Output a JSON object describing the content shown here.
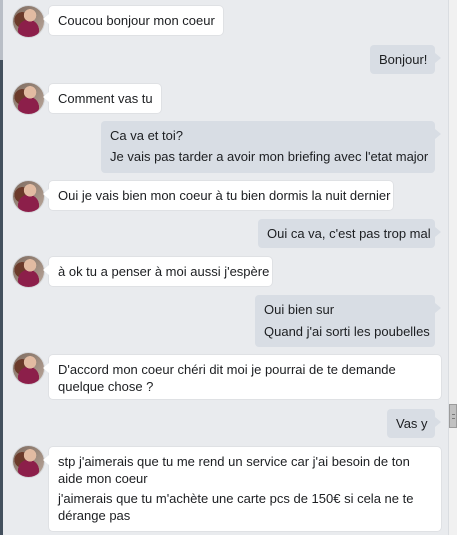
{
  "conversation": {
    "messages": [
      {
        "sender": "contact",
        "lines": [
          "Coucou bonjour mon coeur"
        ]
      },
      {
        "sender": "me",
        "lines": [
          "Bonjour!"
        ]
      },
      {
        "sender": "contact",
        "lines": [
          "Comment vas tu"
        ]
      },
      {
        "sender": "me",
        "lines": [
          "Ca va et toi?",
          "Je vais pas tarder a avoir mon briefing avec l'etat major"
        ]
      },
      {
        "sender": "contact",
        "lines": [
          "Oui je vais bien mon coeur à tu bien dormis la nuit dernier"
        ]
      },
      {
        "sender": "me",
        "lines": [
          "Oui ca va, c'est pas trop mal"
        ]
      },
      {
        "sender": "contact",
        "lines": [
          "à ok tu a penser à moi aussi j'espère"
        ]
      },
      {
        "sender": "me",
        "lines": [
          "Oui bien sur",
          "Quand j'ai sorti les poubelles"
        ]
      },
      {
        "sender": "contact",
        "lines": [
          "D'accord mon coeur chéri dit moi je pourrai de te demande",
          "quelque chose ?"
        ]
      },
      {
        "sender": "me",
        "lines": [
          "Vas y"
        ]
      },
      {
        "sender": "contact",
        "lines": [
          "stp j'aimerais que tu me rend un service car j'ai besoin de ton",
          "aide mon coeur",
          "j'aimerais que tu m'achète une carte pcs de 150€ si cela ne te",
          "dérange pas"
        ]
      }
    ]
  },
  "colors": {
    "background": "#e9ebee",
    "incoming_bubble": "#ffffff",
    "outgoing_bubble": "#d8dde4"
  },
  "icons": {
    "avatar": "contact-avatar"
  }
}
